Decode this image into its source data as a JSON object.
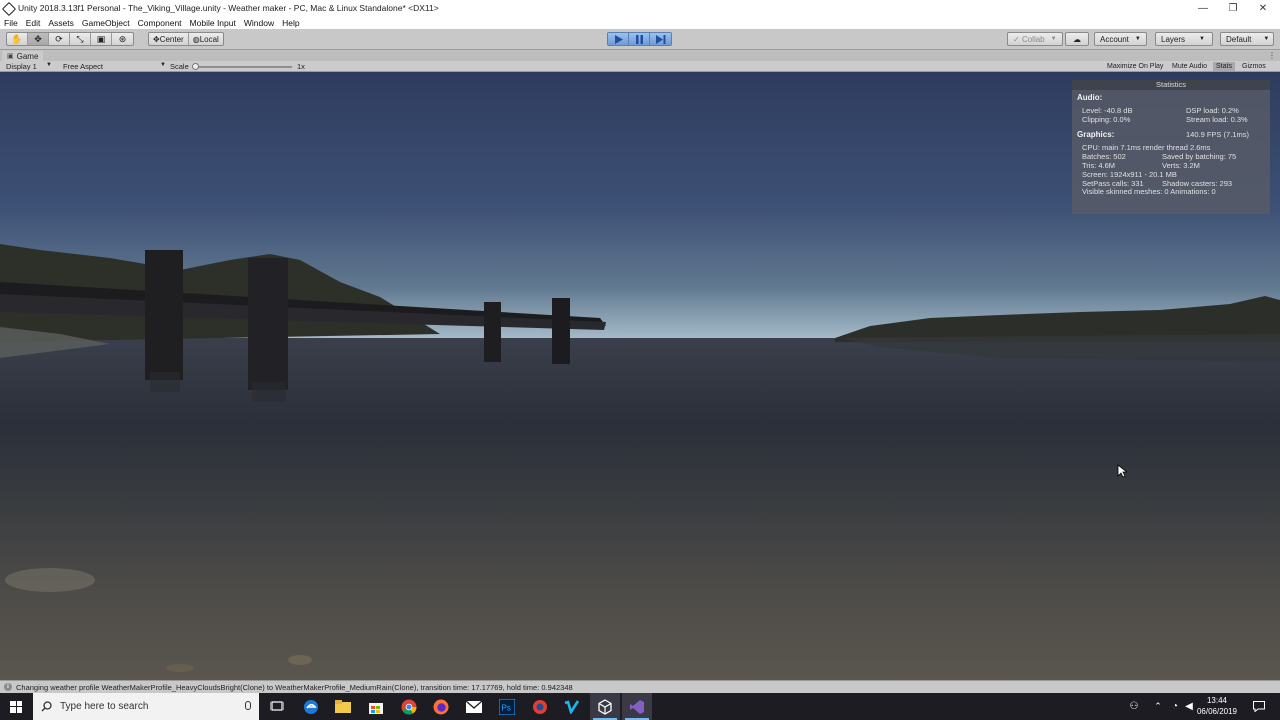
{
  "window": {
    "title": "Unity 2018.3.13f1 Personal - The_Viking_Village.unity - Weather maker - PC, Mac & Linux Standalone* <DX11>",
    "minimize": "—",
    "maximize": "❐",
    "close": "✕"
  },
  "menu": [
    "File",
    "Edit",
    "Assets",
    "GameObject",
    "Component",
    "Mobile Input",
    "Window",
    "Help"
  ],
  "toolbar": {
    "tools": [
      {
        "icon": "hand-tool-icon",
        "glyph": "✋"
      },
      {
        "icon": "move-tool-icon",
        "glyph": "✥"
      },
      {
        "icon": "rotate-tool-icon",
        "glyph": "⟳"
      },
      {
        "icon": "scale-tool-icon",
        "glyph": "⤡"
      },
      {
        "icon": "rect-tool-icon",
        "glyph": "▣"
      },
      {
        "icon": "transform-tool-icon",
        "glyph": "⊛"
      }
    ],
    "pivot_center": "Center",
    "pivot_local": "Local",
    "collab": "Collab",
    "account": "Account",
    "layers": "Layers",
    "layout": "Default"
  },
  "game_view": {
    "tab": "Game",
    "display": "Display 1",
    "aspect": "Free Aspect",
    "scale_label": "Scale",
    "scale_value": "1x",
    "maximize_on_play": "Maximize On Play",
    "mute_audio": "Mute Audio",
    "stats": "Stats",
    "gizmos": "Gizmos"
  },
  "stats": {
    "title": "Statistics",
    "audio_head": "Audio:",
    "level": "Level: -40.8 dB",
    "dsp": "DSP load: 0.2%",
    "clipping": "Clipping: 0.0%",
    "stream": "Stream load: 0.3%",
    "graphics_head": "Graphics:",
    "fps": "140.9 FPS (7.1ms)",
    "cpu": "CPU: main 7.1ms  render thread 2.6ms",
    "batches": "Batches: 502",
    "saved": "Saved by batching: 75",
    "tris": "Tris: 4.6M",
    "verts": "Verts: 3.2M",
    "screen": "Screen: 1924x911 - 20.1 MB",
    "setpass": "SetPass calls: 331",
    "shadow": "Shadow casters: 293",
    "skinned": "Visible skinned meshes: 0  Animations: 0"
  },
  "status": {
    "message": "Changing weather profile WeatherMakerProfile_HeavyCloudsBright(Clone) to WeatherMakerProfile_MediumRain(Clone), transition time: 17.17769, hold time: 0.942348"
  },
  "taskbar": {
    "search_placeholder": "Type here to search",
    "time": "13:44",
    "date": "06/06/2019"
  },
  "colors": {
    "sky_top": "#2f3e60",
    "sky_horizon": "#8fa6b9",
    "water": "#2a2e38",
    "play_accent": "#6f9ad4"
  }
}
